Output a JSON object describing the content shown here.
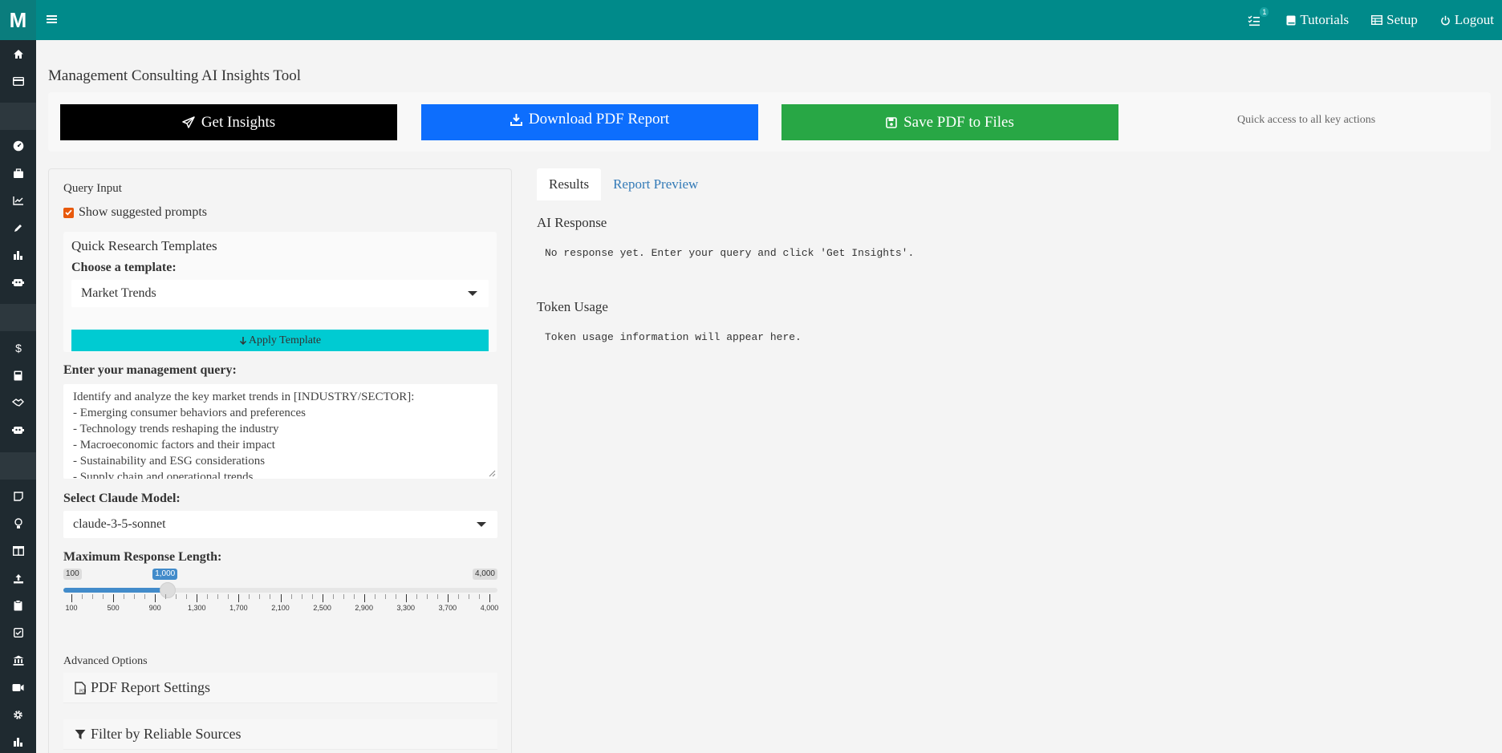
{
  "brand": {
    "logo_letter": "M"
  },
  "header": {
    "tasks_badge": "1",
    "tutorials": "Tutorials",
    "setup": "Setup",
    "logout": "Logout"
  },
  "sidebar": {
    "icons": [
      "home-icon",
      "credit-card-icon",
      "dashboard-icon",
      "briefcase-icon",
      "line-chart-icon",
      "pencil-icon",
      "bar-chart-icon",
      "robot-icon",
      "dollar-icon",
      "calculator-icon",
      "handshake-icon",
      "robot-icon",
      "sticky-note-icon",
      "lightbulb-icon",
      "columns-icon",
      "upload-icon",
      "clipboard-icon",
      "checkbox-icon",
      "bank-icon",
      "video-icon",
      "gear-icon",
      "chart-icon"
    ]
  },
  "page": {
    "title": "Management Consulting AI Insights Tool"
  },
  "actions": {
    "get_insights": "Get Insights",
    "download_pdf": "Download PDF Report",
    "save_pdf": "Save PDF to Files",
    "note": "Quick access to all key actions",
    "colors": {
      "get_insights": "#000000",
      "download_pdf": "#0d6efd",
      "save_pdf": "#28a745"
    }
  },
  "query_panel": {
    "title": "Query Input",
    "show_prompts_label": "Show suggested prompts",
    "show_prompts_checked": true,
    "templates": {
      "title": "Quick Research Templates",
      "choose_label": "Choose a template:",
      "selected": "Market Trends",
      "apply_label": "Apply Template"
    },
    "query_label": "Enter your management query:",
    "query_lines": [
      "Identify and analyze the key market trends in [INDUSTRY/SECTOR]:",
      "- Emerging consumer behaviors and preferences",
      "- Technology trends reshaping the industry",
      "- Macroeconomic factors and their impact",
      "- Sustainability and ESG considerations",
      "- Supply chain and operational trends"
    ],
    "model_label": "Select Claude Model:",
    "model_selected": "claude-3-5-sonnet",
    "length_label": "Maximum Response Length:",
    "length_slider": {
      "min_label": "100",
      "max_label": "4,000",
      "value_label": "1,000",
      "min": 100,
      "max": 4000,
      "value": 1000,
      "tick_labels": [
        "100",
        "500",
        "900",
        "1,300",
        "1,700",
        "2,100",
        "2,500",
        "2,900",
        "3,300",
        "3,700",
        "4,000"
      ]
    },
    "advanced_title": "Advanced Options",
    "pdf_settings": "PDF Report Settings",
    "filter_sources": "Filter by Reliable Sources"
  },
  "results": {
    "tabs": [
      "Results",
      "Report Preview"
    ],
    "ai_response_title": "AI Response",
    "ai_response_text": "No response yet. Enter your query and click 'Get Insights'.",
    "token_title": "Token Usage",
    "token_text": "Token usage information will appear here."
  }
}
